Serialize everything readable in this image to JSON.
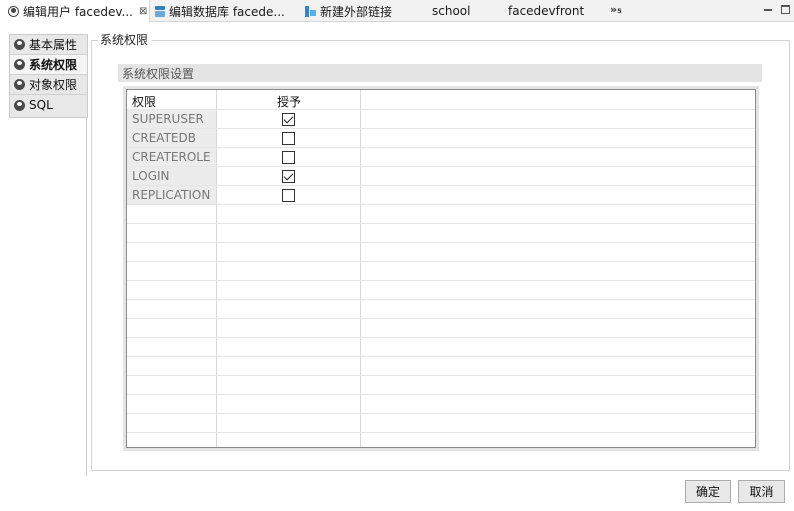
{
  "tabs": [
    {
      "label": "编辑用户 facedev...",
      "icon": "user-circle-icon",
      "close": "⊠",
      "active": true
    },
    {
      "label": "编辑数据库 facede...",
      "icon": "database-icon",
      "active": false
    },
    {
      "label": "新建外部链接",
      "icon": "external-link-icon",
      "active": false
    },
    {
      "label": "school",
      "icon": "grid-icon",
      "active": false
    },
    {
      "label": "facedevfront",
      "icon": "grid-icon",
      "active": false
    }
  ],
  "tab_overflow": "»₅",
  "sidebar": {
    "items": [
      {
        "label": "基本属性",
        "icon": "user-icon",
        "active": false
      },
      {
        "label": "系统权限",
        "icon": "user-icon",
        "active": true
      },
      {
        "label": "对象权限",
        "icon": "user-icon",
        "active": false
      },
      {
        "label": "SQL",
        "icon": "user-icon",
        "active": false
      }
    ]
  },
  "main": {
    "group_title": "系统权限",
    "section_title": "系统权限设置",
    "table": {
      "columns": [
        "权限",
        "授予"
      ],
      "rows": [
        {
          "name": "SUPERUSER",
          "granted": true
        },
        {
          "name": "CREATEDB",
          "granted": false
        },
        {
          "name": "CREATEROLE",
          "granted": false
        },
        {
          "name": "LOGIN",
          "granted": true
        },
        {
          "name": "REPLICATION",
          "granted": false
        }
      ]
    }
  },
  "buttons": {
    "ok_label": "确定",
    "cancel_label": "取消"
  }
}
